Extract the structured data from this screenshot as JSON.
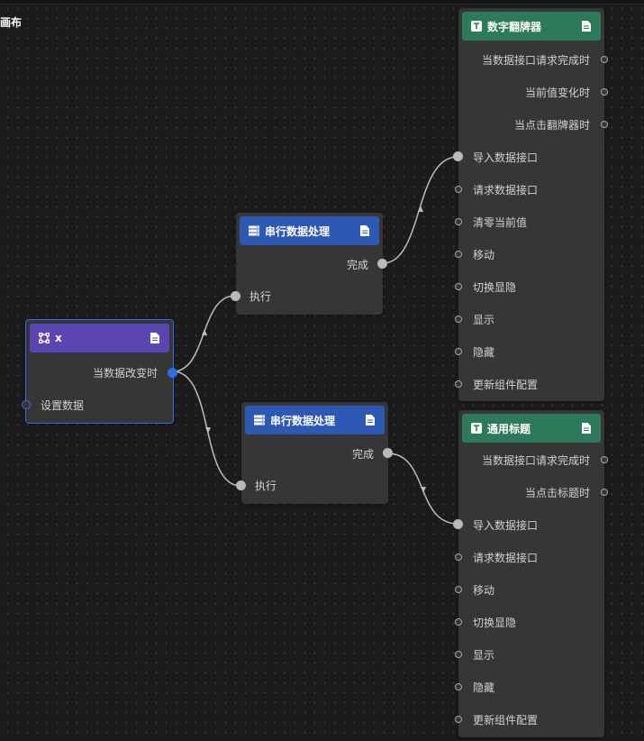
{
  "canvas": {
    "label": "画布"
  },
  "nodes": {
    "x": {
      "title": "x",
      "outputs": [
        "当数据改变时"
      ],
      "inputs": [
        "设置数据"
      ]
    },
    "serial1": {
      "title": "串行数据处理",
      "outputs": [
        "完成"
      ],
      "inputs": [
        "执行"
      ]
    },
    "serial2": {
      "title": "串行数据处理",
      "outputs": [
        "完成"
      ],
      "inputs": [
        "执行"
      ]
    },
    "flipper": {
      "title": "数字翻牌器",
      "outputs": [
        "当数据接口请求完成时",
        "当前值变化时",
        "当点击翻牌器时"
      ],
      "inputs": [
        "导入数据接口",
        "请求数据接口",
        "清零当前值",
        "移动",
        "切换显隐",
        "显示",
        "隐藏",
        "更新组件配置"
      ]
    },
    "titleNode": {
      "title": "通用标题",
      "outputs": [
        "当数据接口请求完成时",
        "当点击标题时"
      ],
      "inputs": [
        "导入数据接口",
        "请求数据接口",
        "移动",
        "切换显隐",
        "显示",
        "隐藏",
        "更新组件配置"
      ]
    }
  },
  "colors": {
    "purple_header": "#5b45b3",
    "blue_header": "#2d59b5",
    "green_header": "#2c7a5b",
    "selection": "#2f6ee8",
    "wire": "#bdbdbd"
  },
  "icons": {
    "x_header": "node-graph-icon",
    "serial_header": "server-stack-icon",
    "component_header": "text-t-icon",
    "header_right": "document-icon"
  }
}
